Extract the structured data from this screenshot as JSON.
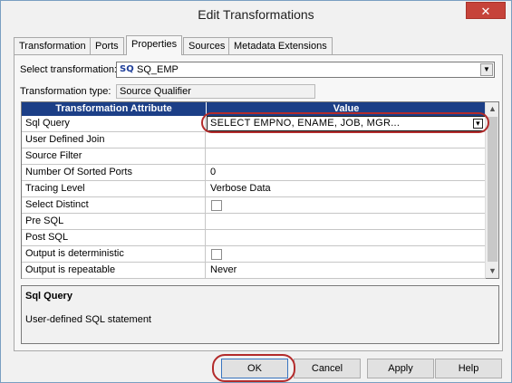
{
  "window": {
    "title": "Edit Transformations",
    "close_label": "✕"
  },
  "tabs": [
    {
      "label": "Transformation"
    },
    {
      "label": "Ports"
    },
    {
      "label": "Properties"
    },
    {
      "label": "Sources"
    },
    {
      "label": "Metadata Extensions"
    }
  ],
  "active_tab": "Properties",
  "select_transformation": {
    "label": "Select transformation:",
    "icon_text": "SQ",
    "value": "SQ_EMP"
  },
  "transformation_type": {
    "label": "Transformation type:",
    "value": "Source Qualifier"
  },
  "grid": {
    "columns": [
      "Transformation Attribute",
      "Value"
    ],
    "rows": [
      {
        "attribute": "Sql Query",
        "value": "SELECT  EMPNO,  ENAME,  JOB,  MGR..."
      },
      {
        "attribute": "User Defined Join",
        "value": ""
      },
      {
        "attribute": "Source Filter",
        "value": ""
      },
      {
        "attribute": "Number Of Sorted Ports",
        "value": "0"
      },
      {
        "attribute": "Tracing Level",
        "value": "Verbose Data"
      },
      {
        "attribute": "Select Distinct",
        "value": ""
      },
      {
        "attribute": "Pre SQL",
        "value": ""
      },
      {
        "attribute": "Post SQL",
        "value": ""
      },
      {
        "attribute": "Output is deterministic",
        "value": ""
      },
      {
        "attribute": "Output is repeatable",
        "value": "Never"
      }
    ]
  },
  "description": {
    "title": "Sql Query",
    "text": "User-defined SQL statement"
  },
  "buttons": {
    "ok": "OK",
    "cancel": "Cancel",
    "apply": "Apply",
    "help": "Help"
  },
  "colors": {
    "grid_header": "#1c3f87",
    "highlight": "#b32b2b",
    "close_button": "#c6433a"
  }
}
